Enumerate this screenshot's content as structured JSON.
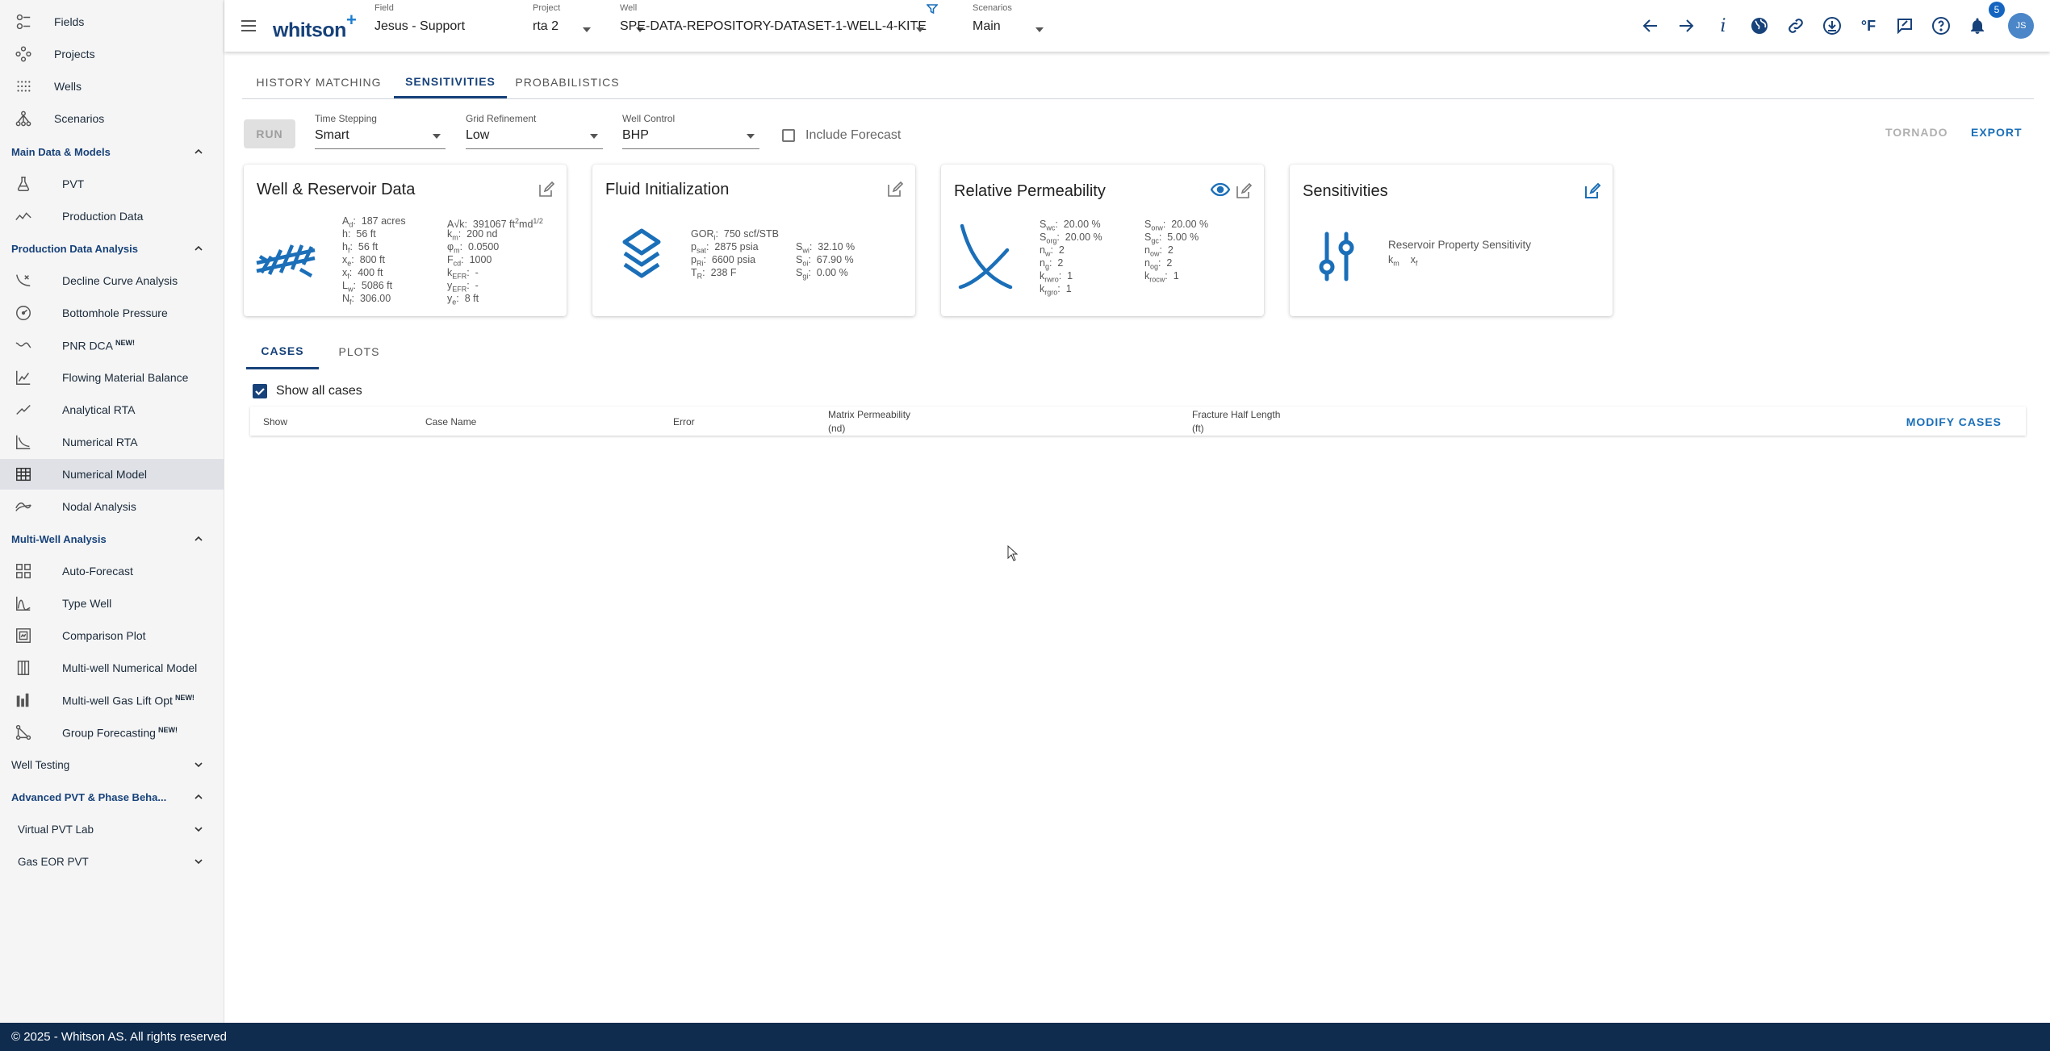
{
  "sidebar": {
    "top_items": [
      {
        "label": "Fields",
        "icon": "fields-icon"
      },
      {
        "label": "Projects",
        "icon": "projects-icon"
      },
      {
        "label": "Wells",
        "icon": "wells-icon"
      },
      {
        "label": "Scenarios",
        "icon": "scenarios-icon"
      }
    ],
    "sections": {
      "main_data": "Main Data & Models",
      "production_data_analysis": "Production Data Analysis",
      "multi_well_analysis": "Multi-Well Analysis",
      "well_testing": "Well Testing",
      "advanced_pvt": "Advanced PVT & Phase Beha...",
      "virtual_pvt_lab": "Virtual PVT Lab",
      "gas_eor_pvt": "Gas EOR PVT"
    },
    "main_items": [
      {
        "label": "PVT",
        "icon": "flask-icon"
      },
      {
        "label": "Production Data",
        "icon": "trend-icon"
      }
    ],
    "pda_items": [
      {
        "label": "Decline Curve Analysis",
        "icon": "decline-icon",
        "new": ""
      },
      {
        "label": "Bottomhole Pressure",
        "icon": "gauge-icon",
        "new": ""
      },
      {
        "label": "PNR DCA",
        "icon": "pnr-icon",
        "new": "NEW!"
      },
      {
        "label": "Flowing Material Balance",
        "icon": "fmb-icon",
        "new": ""
      },
      {
        "label": "Analytical RTA",
        "icon": "analytical-icon",
        "new": ""
      },
      {
        "label": "Numerical RTA",
        "icon": "numerical-rta-icon",
        "new": ""
      },
      {
        "label": "Numerical Model",
        "icon": "grid-model-icon",
        "new": ""
      },
      {
        "label": "Nodal Analysis",
        "icon": "nodal-icon",
        "new": ""
      }
    ],
    "mwa_items": [
      {
        "label": "Auto-Forecast",
        "icon": "autoforecast-icon",
        "new": ""
      },
      {
        "label": "Type Well",
        "icon": "typewell-icon",
        "new": ""
      },
      {
        "label": "Comparison Plot",
        "icon": "comparison-icon",
        "new": ""
      },
      {
        "label": "Multi-well Numerical Model",
        "icon": "multiwell-icon",
        "new": ""
      },
      {
        "label": "Multi-well Gas Lift Opt",
        "icon": "gaslift-icon",
        "new": "NEW!"
      },
      {
        "label": "Group Forecasting",
        "icon": "group-icon",
        "new": "NEW!"
      }
    ]
  },
  "header": {
    "logo": "whitson",
    "logo_plus": "+",
    "field_caption": "Field",
    "field_value": "Jesus - Support",
    "project_caption": "Project",
    "project_value": "rta 2",
    "well_caption": "Well",
    "well_value": "SPE-DATA-REPOSITORY-DATASET-1-WELL-4-KITE",
    "scenario_caption": "Scenarios",
    "scenario_value": "Main",
    "info_glyph": "i",
    "temp_unit": "°F",
    "notification_count": "5",
    "avatar_initials": "JS"
  },
  "tabs": [
    "HISTORY MATCHING",
    "SENSITIVITIES",
    "PROBABILISTICS"
  ],
  "controls": {
    "run_label": "RUN",
    "time_stepping_caption": "Time Stepping",
    "time_stepping_value": "Smart",
    "grid_refinement_caption": "Grid Refinement",
    "grid_refinement_value": "Low",
    "well_control_caption": "Well Control",
    "well_control_value": "BHP",
    "include_forecast_label": "Include Forecast",
    "tornado_label": "TORNADO",
    "export_label": "EXPORT"
  },
  "cards": {
    "well_reservoir": {
      "title": "Well & Reservoir Data",
      "col1": [
        {
          "sym": "A",
          "sub": "d",
          "val": "187 acres"
        },
        {
          "sym": "h",
          "sub": "",
          "val": "56 ft"
        },
        {
          "sym": "h",
          "sub": "f",
          "val": "56 ft"
        },
        {
          "sym": "x",
          "sub": "e",
          "val": "800 ft"
        },
        {
          "sym": "x",
          "sub": "f",
          "val": "400 ft"
        },
        {
          "sym": "L",
          "sub": "w",
          "val": "5086 ft"
        },
        {
          "sym": "N",
          "sub": "f",
          "val": "306.00"
        }
      ],
      "col2": [
        {
          "sym": "A√k",
          "sub": "",
          "val": "391067 ft",
          "sup": "2",
          "val2": "md",
          "sup2": "1/2"
        },
        {
          "sym": "k",
          "sub": "m",
          "val": "200 nd"
        },
        {
          "sym": "φ",
          "sub": "m",
          "val": "0.0500"
        },
        {
          "sym": "F",
          "sub": "cd",
          "val": "1000"
        },
        {
          "sym": "k",
          "sub": "EFR",
          "val": "-"
        },
        {
          "sym": "y",
          "sub": "EFR",
          "val": "-"
        },
        {
          "sym": "y",
          "sub": "e",
          "val": "8 ft"
        }
      ]
    },
    "fluid_init": {
      "title": "Fluid Initialization",
      "col1": [
        {
          "sym": "GOR",
          "sub": "i",
          "val": "750 scf/STB"
        },
        {
          "sym": "p",
          "sub": "sat",
          "val": "2875 psia"
        },
        {
          "sym": "p",
          "sub": "Ri",
          "val": "6600 psia"
        },
        {
          "sym": "T",
          "sub": "R",
          "val": "238 F"
        }
      ],
      "col2": [
        {
          "sym": "S",
          "sub": "wi",
          "val": "32.10 %"
        },
        {
          "sym": "S",
          "sub": "oi",
          "val": "67.90 %"
        },
        {
          "sym": "S",
          "sub": "gi",
          "val": "0.00 %"
        }
      ]
    },
    "rel_perm": {
      "title": "Relative Permeability",
      "col1": [
        {
          "sym": "S",
          "sub": "wc",
          "val": "20.00 %"
        },
        {
          "sym": "S",
          "sub": "org",
          "val": "20.00 %"
        },
        {
          "sym": "n",
          "sub": "w",
          "val": "2"
        },
        {
          "sym": "n",
          "sub": "g",
          "val": "2"
        },
        {
          "sym": "k",
          "sub": "rwro",
          "val": "1"
        },
        {
          "sym": "k",
          "sub": "rgro",
          "val": "1"
        }
      ],
      "col2": [
        {
          "sym": "S",
          "sub": "orw",
          "val": "20.00 %"
        },
        {
          "sym": "S",
          "sub": "gc",
          "val": "5.00 %"
        },
        {
          "sym": "n",
          "sub": "ow",
          "val": "2"
        },
        {
          "sym": "n",
          "sub": "og",
          "val": "2"
        },
        {
          "sym": "k",
          "sub": "rocw",
          "val": "1"
        }
      ]
    },
    "sensitivities": {
      "title": "Sensitivities",
      "subtitle": "Reservoir Property Sensitivity",
      "params": [
        {
          "sym": "k",
          "sub": "m"
        },
        {
          "sym": "x",
          "sub": "f"
        }
      ]
    }
  },
  "subtabs": [
    "CASES",
    "PLOTS"
  ],
  "show_all_label": "Show all cases",
  "table": {
    "headers": [
      "Show",
      "Case Name",
      "Error",
      "Matrix Permeability",
      "Fracture Half Length"
    ],
    "units": {
      "matrix": "(nd)",
      "fracture": "(ft)"
    },
    "modify_label": "MODIFY CASES"
  },
  "footer": "© 2025 - Whitson AS. All rights reserved",
  "colors": {
    "primary": "#17427a",
    "accent": "#1b6fb8",
    "footer": "#0f2c4e",
    "active_nav": "#dfe1e6"
  }
}
